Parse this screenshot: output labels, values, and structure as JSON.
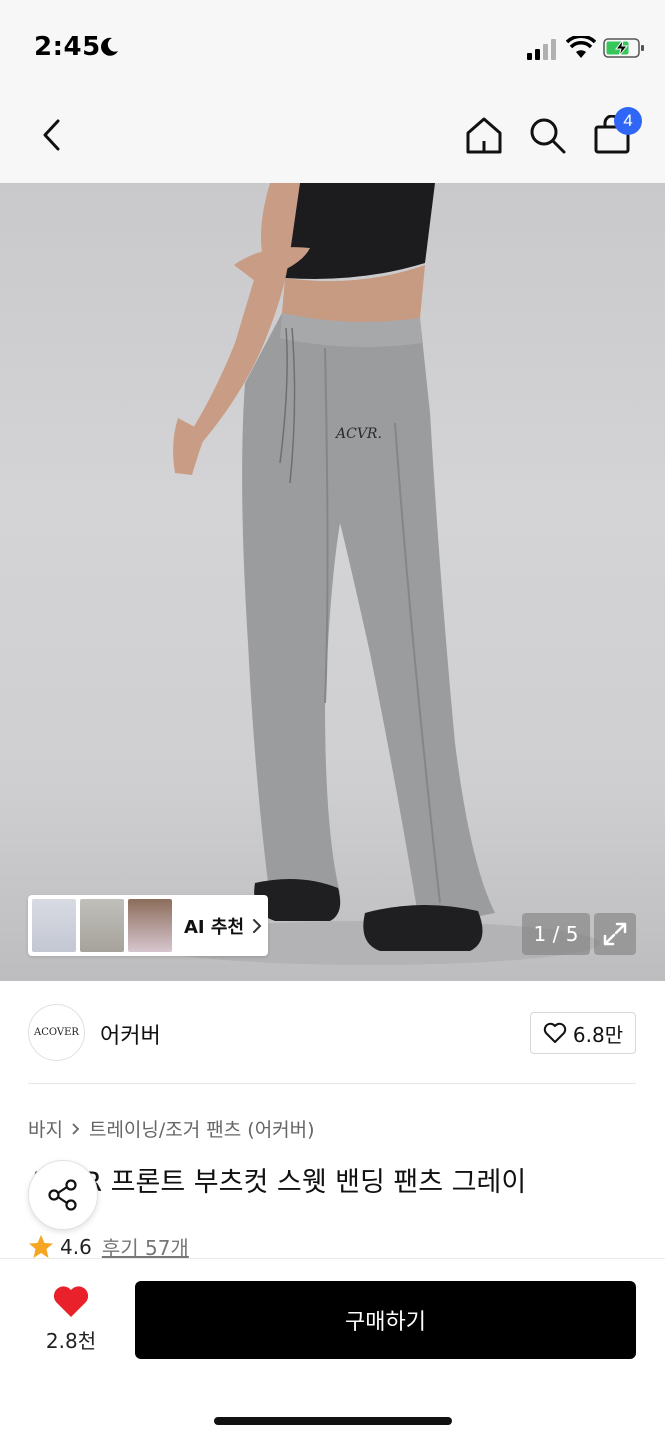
{
  "status_bar": {
    "time": "2:45"
  },
  "nav": {
    "cart_count": "4"
  },
  "gallery": {
    "counter": "1 / 5",
    "ai_label": "AI 추천",
    "logo_text": "ACVR."
  },
  "brand": {
    "logo_text": "ACOVER",
    "name": "어커버",
    "likes": "6.8만"
  },
  "breadcrumb": {
    "category": "바지",
    "subcategory": "트레이닝/조거 팬츠 (어커버)"
  },
  "product": {
    "title": "ACVR 프론트 부츠컷 스웻 밴딩 팬츠 그레이",
    "rating": "4.6",
    "reviews": "후기 57개"
  },
  "bottom": {
    "wish_count": "2.8천",
    "buy_label": "구매하기"
  },
  "colors": {
    "accent": "#2f66f5",
    "heart": "#e8212b",
    "star": "#f5a623"
  }
}
